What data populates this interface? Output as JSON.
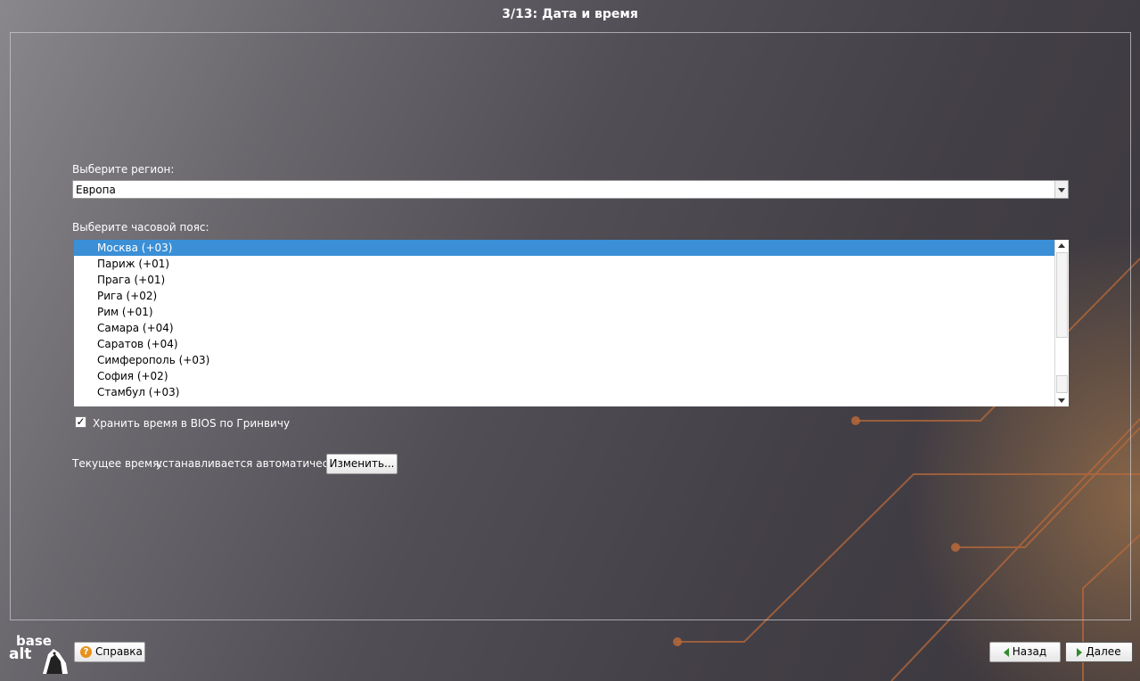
{
  "window": {
    "title": "3/13: Дата и время"
  },
  "region": {
    "label": "Выберите регион:",
    "selected": "Европа"
  },
  "timezone": {
    "label": "Выберите часовой пояс:",
    "items": [
      "Москва (+03)",
      "Париж (+01)",
      "Прага (+01)",
      "Рига (+02)",
      "Рим (+01)",
      "Самара (+04)",
      "Саратов (+04)",
      "Симферополь (+03)",
      "София (+02)",
      "Стамбул (+03)"
    ],
    "selected_index": 0
  },
  "bios_utc": {
    "label": "Хранить время в BIOS по Гринвичу",
    "checked": true,
    "check_glyph": "✓"
  },
  "current_time": {
    "label": "Текущее время:",
    "value": "устанавливается автоматически",
    "change_button": "Изменить..."
  },
  "footer": {
    "logo_top": "base",
    "logo_bottom": "alt",
    "help_button": "Справка",
    "help_icon": "?",
    "back_button": "Назад",
    "next_button": "Далее"
  },
  "colors": {
    "selection": "#3a8fd6",
    "accent_lines": "#c0703c",
    "help_icon": "#e8911c",
    "nav_arrow": "#2e8b2e"
  }
}
